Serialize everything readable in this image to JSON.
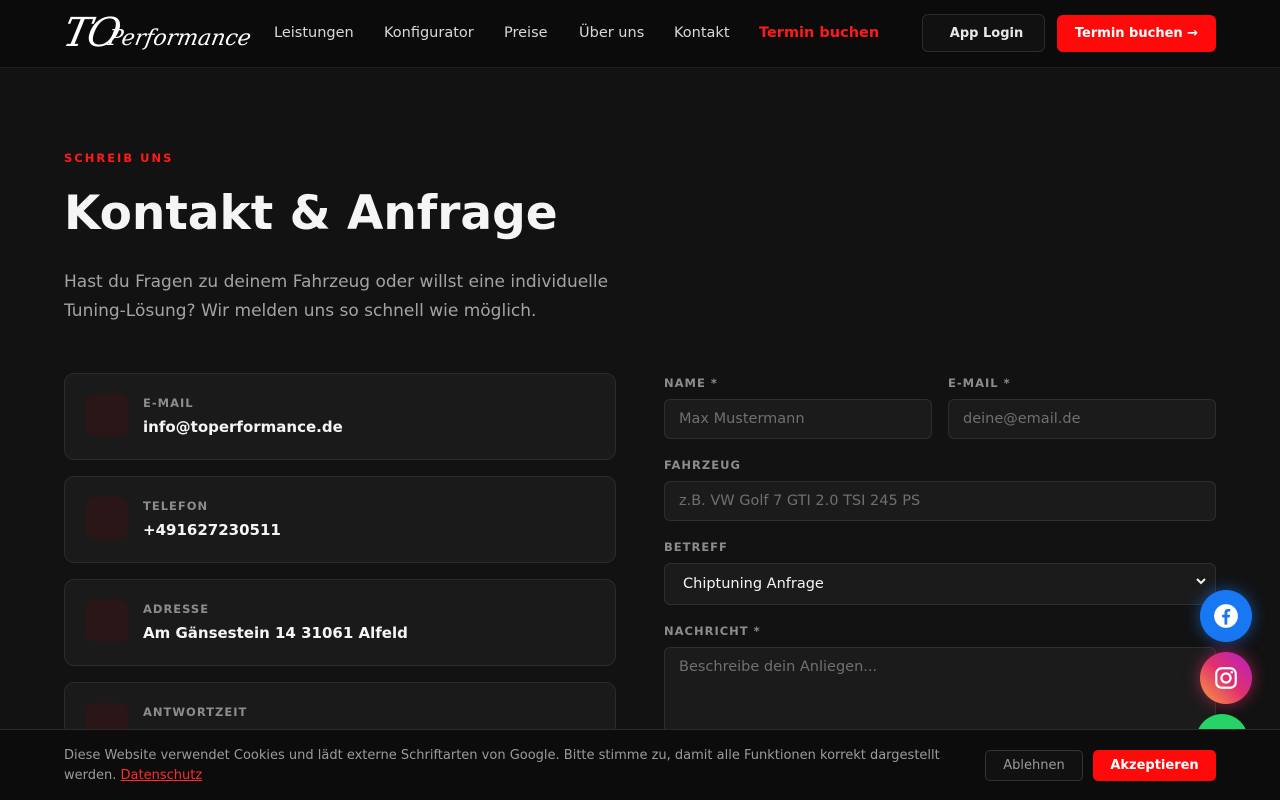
{
  "header": {
    "logo_big": "TO",
    "logo_small": "Performance",
    "nav": [
      "Leistungen",
      "Konfigurator",
      "Preise",
      "Über uns",
      "Kontakt",
      "Termin buchen"
    ],
    "login_icon": "",
    "login_label": "App Login",
    "book_label": "Termin buchen →"
  },
  "hero": {
    "eyebrow": "SCHREIB UNS",
    "title": "Kontakt & Anfrage",
    "intro": "Hast du Fragen zu deinem Fahrzeug oder willst eine individuelle Tuning-Lösung? Wir melden uns so schnell wie möglich."
  },
  "contact": [
    {
      "icon": "",
      "icon_name": "mail-icon",
      "label": "E-MAIL",
      "value": "info@toperformance.de"
    },
    {
      "icon": "",
      "icon_name": "phone-icon",
      "label": "TELEFON",
      "value": "+491627230511"
    },
    {
      "icon": "",
      "icon_name": "map-pin-icon",
      "label": "ADRESSE",
      "value": "Am Gänsestein 14 31061 Alfeld"
    },
    {
      "icon": "",
      "icon_name": "clock-icon",
      "label": "ANTWORTZEIT",
      "value": ""
    }
  ],
  "form": {
    "name_label": "NAME *",
    "name_placeholder": "Max Mustermann",
    "email_label": "E-MAIL *",
    "email_placeholder": "deine@email.de",
    "vehicle_label": "FAHRZEUG",
    "vehicle_placeholder": "z.B. VW Golf 7 GTI 2.0 TSI 245 PS",
    "subject_label": "BETREFF",
    "subject_value": "Chiptuning Anfrage",
    "message_label": "NACHRICHT *",
    "message_placeholder": "Beschreibe dein Anliegen..."
  },
  "social": {
    "facebook_icon": "facebook-icon",
    "instagram_icon": "instagram-icon",
    "whatsapp_icon": "whatsapp-icon"
  },
  "cookie": {
    "text": "Diese Website verwendet Cookies und lädt externe Schriftarten von Google. Bitte stimme zu, damit alle Funktionen korrekt dargestellt werden.",
    "link": "Datenschutz",
    "decline": "Ablehnen",
    "accept": "Akzeptieren"
  },
  "colors": {
    "accent": "#ff0a0a",
    "background": "#121212",
    "card": "#1a1a1a"
  }
}
